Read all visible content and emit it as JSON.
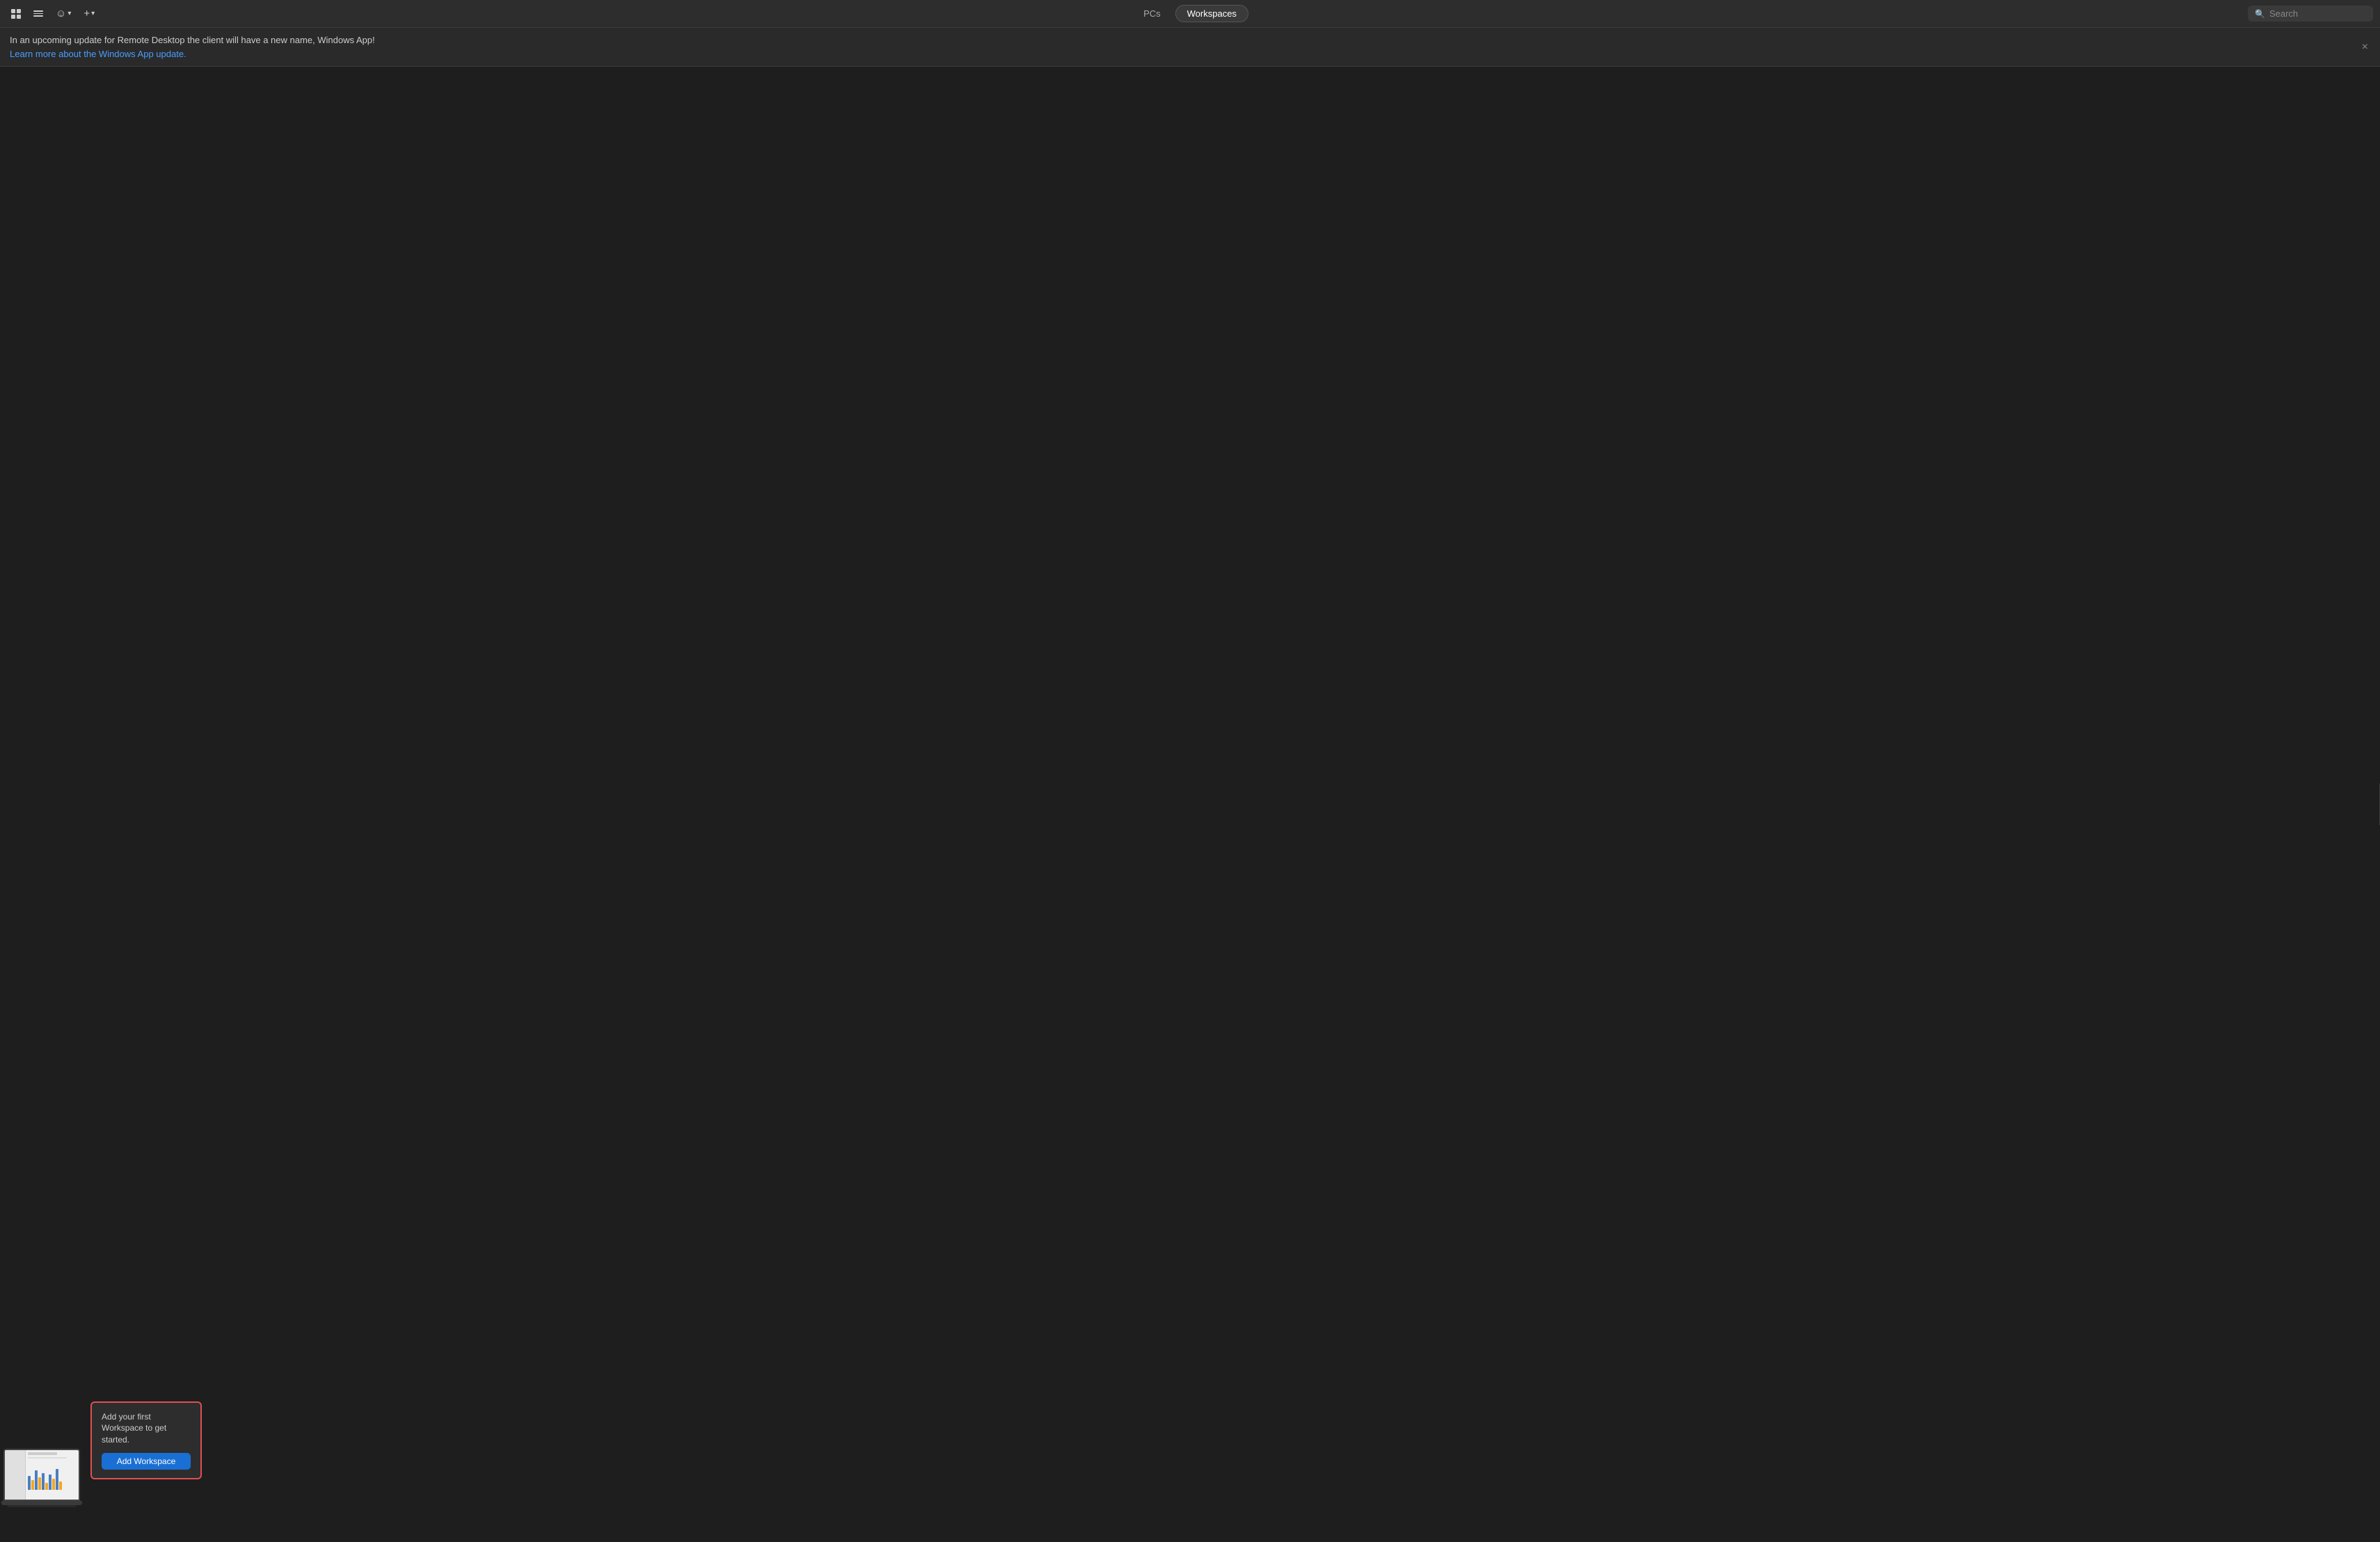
{
  "toolbar": {
    "tabs": [
      {
        "id": "pcs",
        "label": "PCs",
        "active": false
      },
      {
        "id": "workspaces",
        "label": "Workspaces",
        "active": true
      }
    ],
    "add_label": "+",
    "grid_btn_label": "grid",
    "menu_btn_label": "menu",
    "smiley_btn_label": "☺",
    "chevron_down": "▾"
  },
  "search": {
    "placeholder": "Search"
  },
  "banner": {
    "message": "In an upcoming update for Remote Desktop the client will have a new name, Windows App!",
    "link_text": "Learn more about the Windows App update.",
    "close_label": "×"
  },
  "callout": {
    "description": "Add your first Workspace to get started.",
    "add_button": "Add Workspace"
  },
  "bars": [
    {
      "height": 20,
      "color": "#4a7fc1"
    },
    {
      "height": 14,
      "color": "#f5a623"
    },
    {
      "height": 28,
      "color": "#4a7fc1"
    },
    {
      "height": 18,
      "color": "#f5a623"
    },
    {
      "height": 24,
      "color": "#4a7fc1"
    },
    {
      "height": 10,
      "color": "#f5a623"
    },
    {
      "height": 22,
      "color": "#4a7fc1"
    },
    {
      "height": 16,
      "color": "#f5a623"
    },
    {
      "height": 30,
      "color": "#4a7fc1"
    },
    {
      "height": 12,
      "color": "#f5a623"
    }
  ]
}
